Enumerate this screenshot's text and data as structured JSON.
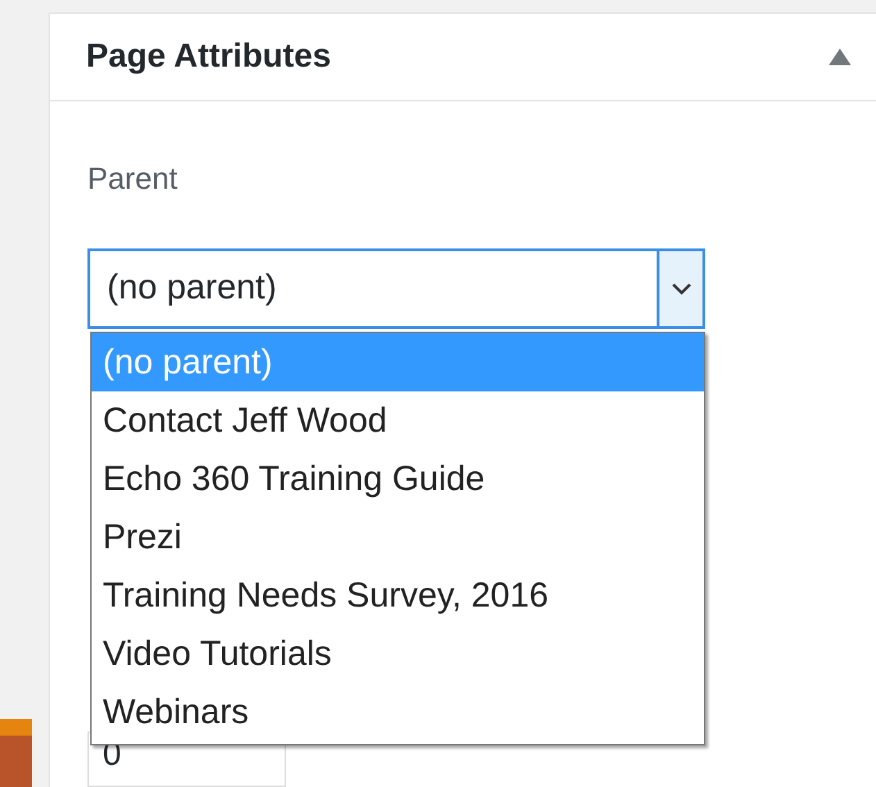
{
  "panel": {
    "title": "Page Attributes",
    "expanded": true
  },
  "parent": {
    "label": "Parent",
    "value": "(no parent)",
    "options": [
      {
        "label": "(no parent)",
        "selected": true
      },
      {
        "label": "Contact Jeff Wood",
        "selected": false
      },
      {
        "label": "Echo 360 Training Guide",
        "selected": false
      },
      {
        "label": "Prezi",
        "selected": false
      },
      {
        "label": "Training Needs Survey, 2016",
        "selected": false
      },
      {
        "label": "Video Tutorials",
        "selected": false
      },
      {
        "label": "Webinars",
        "selected": false
      }
    ]
  },
  "order": {
    "value": "0"
  }
}
